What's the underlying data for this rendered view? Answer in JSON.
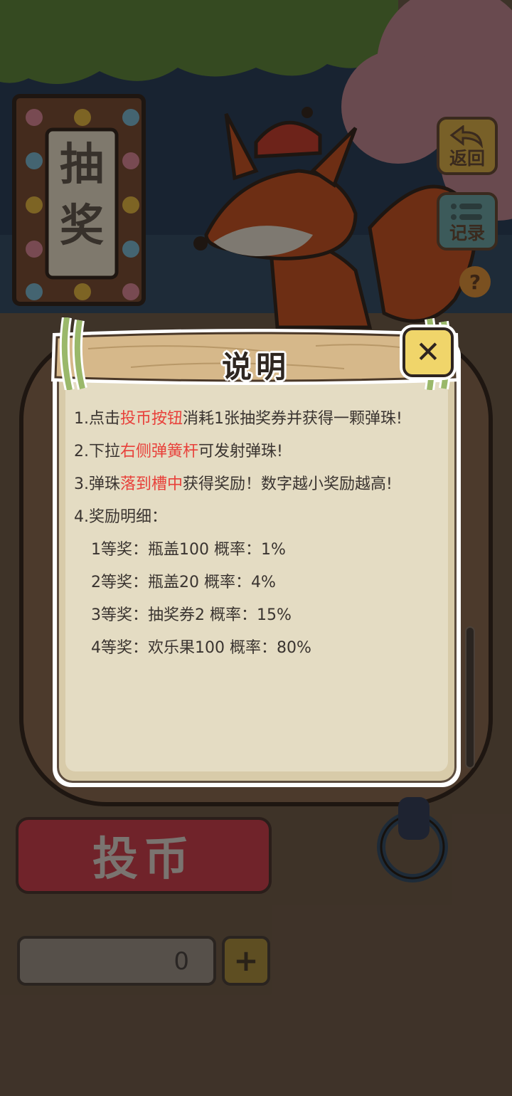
{
  "sign": {
    "chars": [
      "抽",
      "奖"
    ]
  },
  "side_buttons": {
    "back_label": "返回",
    "records_label": "记录",
    "help_label": "?"
  },
  "bottom": {
    "coin_button_label": "投币",
    "ticket_count": "0",
    "add_label": "+"
  },
  "modal": {
    "title": "说明",
    "close_label": "✕",
    "rule1": {
      "n": "1.点击",
      "hl": "投币按钮",
      "rest": "消耗1张抽奖券并获得一颗弹珠!"
    },
    "rule2": {
      "n": "2.下拉",
      "hl": "右侧弹簧杆",
      "rest": "可发射弹珠!"
    },
    "rule3": {
      "n": "3.弹珠",
      "hl": "落到槽中",
      "rest": "获得奖励！数字越小奖励越高!"
    },
    "rule4": "4.奖励明细：",
    "prizes": [
      "1等奖：瓶盖100 概率：1%",
      "2等奖：瓶盖20 概率：4%",
      "3等奖：抽奖券2 概率：15%",
      "4等奖：欢乐果100 概率：80%"
    ]
  },
  "colors": {
    "highlight": "#e8403a",
    "paper": "#e4dcc3",
    "close_button": "#f0d56a",
    "coin_button": "#70232a"
  }
}
